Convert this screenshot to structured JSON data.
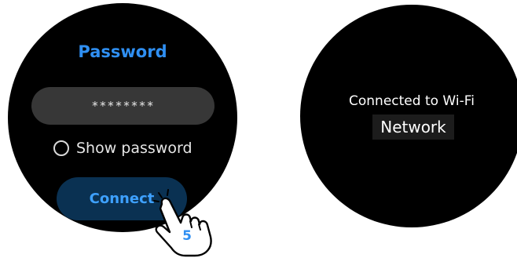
{
  "password_screen": {
    "title": "Password",
    "password_value": "********",
    "show_password_label": "Show password",
    "connect_label": "Connect",
    "step_number": "5"
  },
  "result_screen": {
    "message_line": "Connected to Wi-Fi",
    "network_name": "Network"
  },
  "icons": {
    "radio": "radio-unchecked-icon",
    "gesture": "tap-hand-icon"
  },
  "colors": {
    "accent": "#2f8ff2",
    "watch_face": "#000000",
    "button_bg": "#0a3152",
    "field_bg": "#373737"
  }
}
